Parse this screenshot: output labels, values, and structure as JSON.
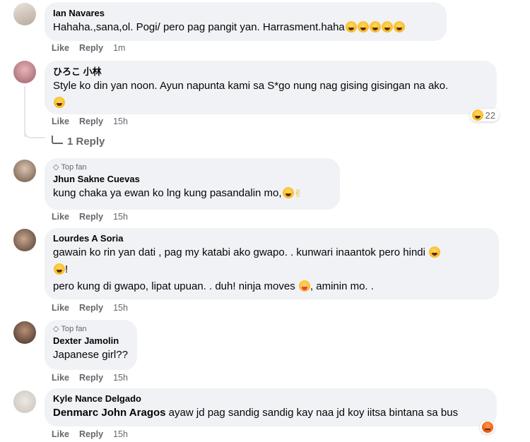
{
  "comments": [
    {
      "author": "Ian Navares",
      "top_fan": "",
      "text": "Hahaha.,sana,ol. Pogi/ pero pag pangit yan. Harrasment.haha",
      "like": "Like",
      "reply": "Reply",
      "time": "1m",
      "emojis": [
        "crying-face-emoji",
        "crying-face-emoji",
        "grinning-face-emoji",
        "laughing-face-emoji",
        "laughing-face-emoji"
      ]
    },
    {
      "author": "ひろこ 小林",
      "top_fan": "",
      "text_line1": "Style ko din yan noon. Ayun napunta kami sa S*go nung nag gising gisingan na ako.",
      "like": "Like",
      "reply": "Reply",
      "time": "15h",
      "reaction_count": "22",
      "replies_label": "1 Reply"
    },
    {
      "author": "Jhun Sakne Cuevas",
      "top_fan": "Top fan",
      "text": "kung chaka ya ewan ko lng kung pasandalin mo,",
      "like": "Like",
      "reply": "Reply",
      "time": "15h"
    },
    {
      "author": "Lourdes A Soria",
      "top_fan": "",
      "text_line1": "gawain ko rin yan dati , pag my katabi ako gwapo. . kunwari inaantok pero hindi",
      "text_line2": "!",
      "text_line3a": "pero kung di gwapo, lipat upuan. . duh! ninja moves",
      "text_line3b": ", aminin mo. .",
      "like": "Like",
      "reply": "Reply",
      "time": "15h"
    },
    {
      "author": "Dexter Jamolin",
      "top_fan": "Top fan",
      "text": "Japanese girl??",
      "like": "Like",
      "reply": "Reply",
      "time": "15h"
    },
    {
      "author": "Kyle Nance Delgado",
      "top_fan": "",
      "mention": "Denmarc John Aragos",
      "text": "ayaw jd pag sandig sandig kay naa jd koy iitsa bintana sa bus",
      "like": "Like",
      "reply": "Reply",
      "time": "15h"
    }
  ],
  "colors": {
    "bubble": "#f0f2f5",
    "meta": "#65676b",
    "text": "#050505"
  }
}
